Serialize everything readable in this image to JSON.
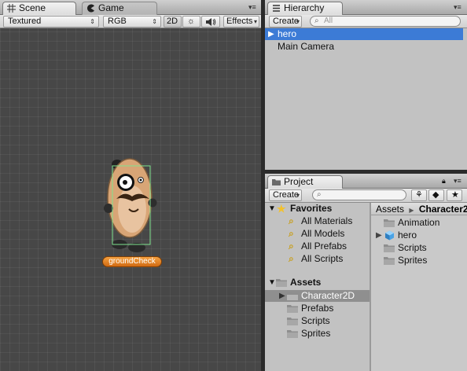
{
  "scene_view": {
    "tabs": [
      {
        "label": "Scene",
        "icon": "grid-icon",
        "active": true
      },
      {
        "label": "Game",
        "icon": "pacman-icon",
        "active": false
      }
    ],
    "toolbar": {
      "shading_mode": "Textured",
      "render_mode": "RGB",
      "mode_2d": "2D",
      "effects": "Effects"
    },
    "character_label": "groundCheck"
  },
  "hierarchy": {
    "tab_label": "Hierarchy",
    "create_label": "Create",
    "search_placeholder": "All",
    "items": [
      {
        "label": "hero",
        "selected": true,
        "expandable": true
      },
      {
        "label": "Main Camera",
        "selected": false,
        "expandable": false
      }
    ]
  },
  "project": {
    "tab_label": "Project",
    "create_label": "Create",
    "tree": {
      "favorites_label": "Favorites",
      "favorites": [
        "All Materials",
        "All Models",
        "All Prefabs",
        "All Scripts"
      ],
      "assets_label": "Assets",
      "assets": [
        {
          "label": "Character2D",
          "selected": true
        },
        {
          "label": "Prefabs",
          "selected": false
        },
        {
          "label": "Scripts",
          "selected": false
        },
        {
          "label": "Sprites",
          "selected": false
        }
      ]
    },
    "breadcrumb": {
      "root": "Assets",
      "current": "Character2"
    },
    "contents": [
      {
        "label": "Animation",
        "kind": "folder"
      },
      {
        "label": "hero",
        "kind": "prefab"
      },
      {
        "label": "Scripts",
        "kind": "folder"
      },
      {
        "label": "Sprites",
        "kind": "folder"
      }
    ]
  },
  "colors": {
    "selection": "#3c7bd6",
    "scene_bg": "#474747",
    "panel_bg": "#c2c2c2",
    "label_orange": "#e07d1e"
  }
}
